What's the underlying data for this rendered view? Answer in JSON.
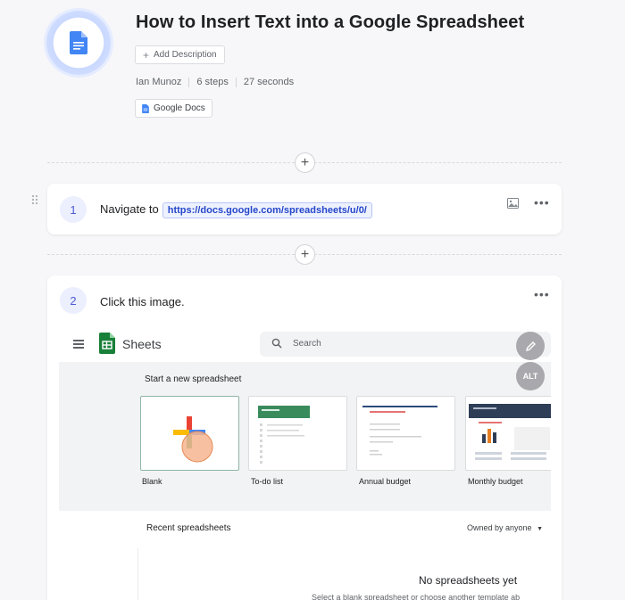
{
  "header": {
    "title": "How to Insert Text into a Google Spreadsheet",
    "add_description": "Add Description",
    "author": "Ian Munoz",
    "steps": "6 steps",
    "duration": "27 seconds",
    "app_tag": "Google Docs"
  },
  "steps": [
    {
      "number": "1",
      "text": "Navigate to",
      "url": "https://docs.google.com/spreadsheets/u/0/"
    },
    {
      "number": "2",
      "text": "Click this image."
    }
  ],
  "screenshot": {
    "app_name": "Sheets",
    "search_placeholder": "Search",
    "alt_badge": "ALT",
    "gallery_title": "Start a new spreadsheet",
    "templates": [
      "Blank",
      "To-do list",
      "Annual budget",
      "Monthly budget"
    ],
    "recent_title": "Recent spreadsheets",
    "owner_filter": "Owned by anyone",
    "empty_title": "No spreadsheets yet",
    "empty_subtitle": "Select a blank spreadsheet or choose another template ab"
  },
  "colors": {
    "accent": "#4a5bd5",
    "sheets_green": "#188038",
    "link": "#2647c9"
  }
}
